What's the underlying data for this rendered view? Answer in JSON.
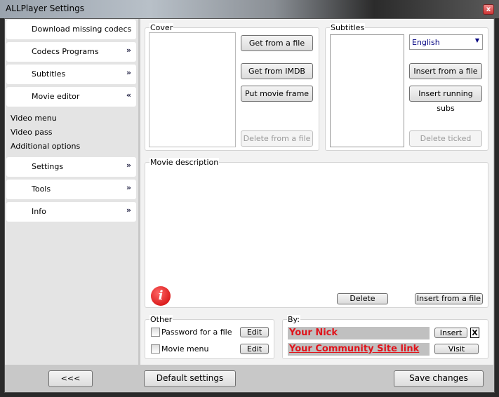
{
  "window": {
    "title": "ALLPlayer Settings",
    "close": "x"
  },
  "sidebar": {
    "items": [
      {
        "label": "Download missing codecs",
        "chevron": ""
      },
      {
        "label": "Codecs Programs",
        "chevron": "»"
      },
      {
        "label": "Subtitles",
        "chevron": "»"
      },
      {
        "label": "Movie editor",
        "chevron": "«"
      }
    ],
    "subitems": [
      "Video menu",
      "Video pass",
      "Additional options"
    ],
    "items2": [
      {
        "label": "Settings",
        "chevron": "»"
      },
      {
        "label": "Tools",
        "chevron": "»"
      },
      {
        "label": "Info",
        "chevron": "»"
      }
    ]
  },
  "cover": {
    "label": "Cover",
    "get_file": "Get from a file",
    "get_imdb": "Get from IMDB",
    "put_frame": "Put movie frame",
    "delete": "Delete from a file"
  },
  "subtitles": {
    "label": "Subtitles",
    "language": "English",
    "insert_file": "Insert from a file",
    "insert_running": "Insert running subs",
    "delete_ticked": "Delete ticked"
  },
  "description": {
    "label": "Movie description",
    "delete": "Delete",
    "insert_file": "Insert from a file",
    "info_icon": "i"
  },
  "other": {
    "label": "Other",
    "password": "Password for a file",
    "movie_menu": "Movie menu",
    "edit": "Edit"
  },
  "by": {
    "label": "By:",
    "nick": "Your Nick",
    "site": "Your Community Site link",
    "insert": "Insert",
    "x": "X",
    "visit": "Visit"
  },
  "footer": {
    "back": "<<<",
    "default": "Default settings",
    "save": "Save changes"
  }
}
